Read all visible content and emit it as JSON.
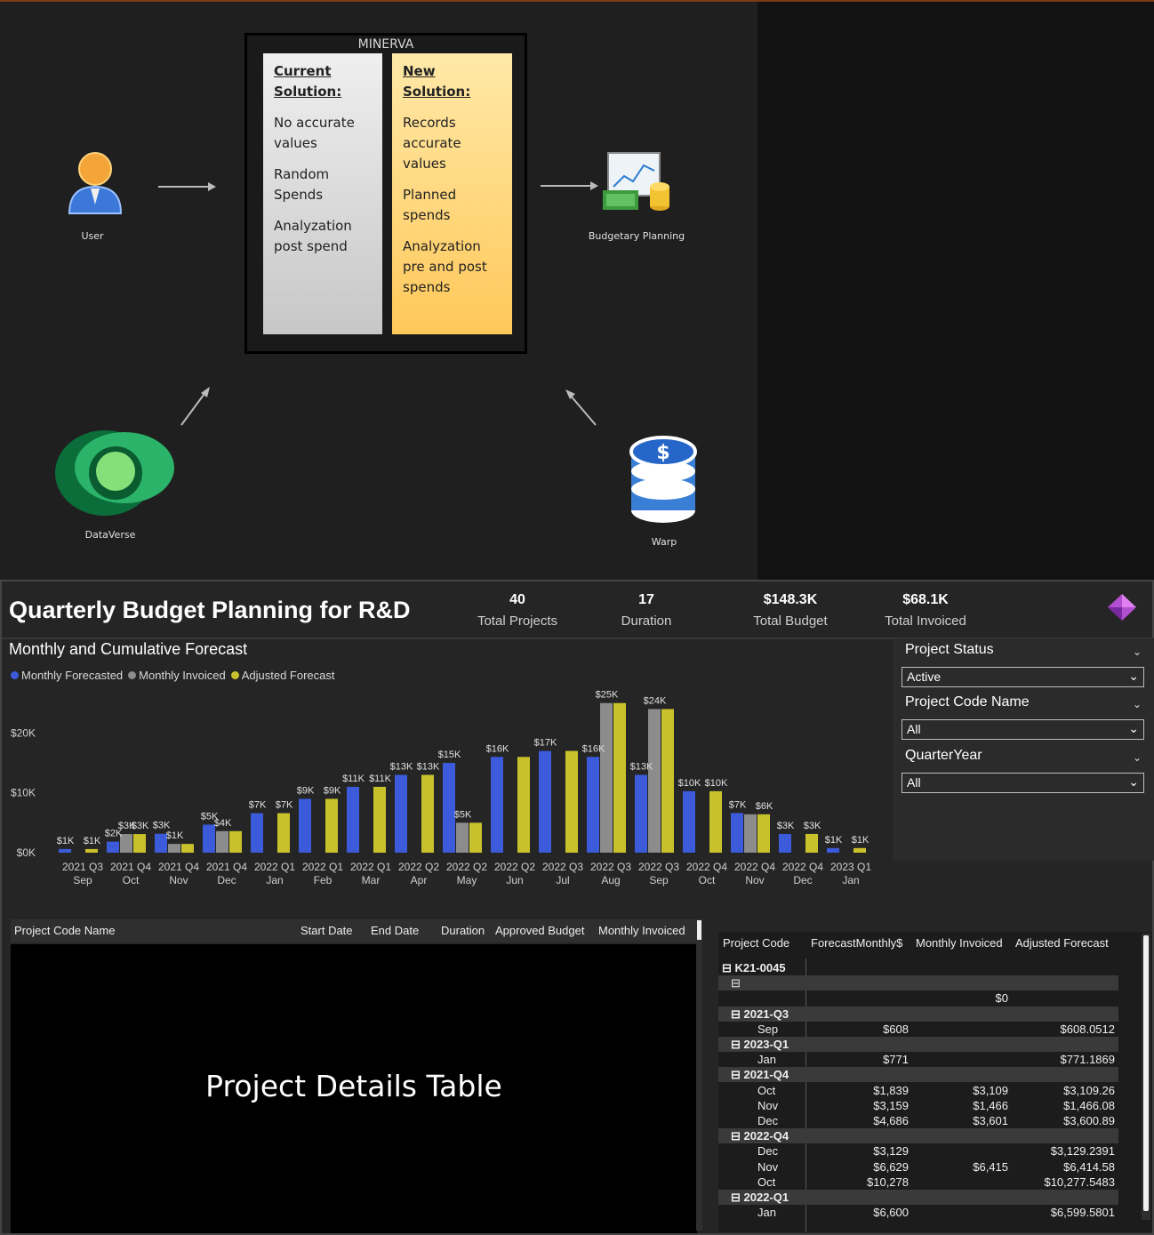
{
  "diagram": {
    "minerva_title": "MINERVA",
    "current": {
      "heading_1": "Current",
      "heading_2": "Solution:",
      "items": [
        "No accurate values",
        "Random Spends",
        "Analyzation post spend"
      ]
    },
    "new": {
      "heading_1": "New",
      "heading_2": "Solution:",
      "items": [
        "Records accurate values",
        "Planned spends",
        "Analyzation pre and post spends"
      ]
    },
    "nodes": {
      "user": "User",
      "budgetary": "Budgetary Planning",
      "dataverse": "DataVerse",
      "warp": "Warp"
    }
  },
  "dashboard": {
    "title": "Quarterly Budget Planning for R&D",
    "kpis": [
      {
        "value": "40",
        "label": "Total Projects"
      },
      {
        "value": "17",
        "label": "Duration"
      },
      {
        "value": "$148.3K",
        "label": "Total Budget"
      },
      {
        "value": "$68.1K",
        "label": "Total Invoiced"
      }
    ],
    "chart_title": "Monthly and Cumulative Forecast",
    "colors": {
      "forecasted": "#3b5bdb",
      "invoiced": "#8c8c8c",
      "adjusted": "#c9c12c"
    }
  },
  "chart_data": {
    "type": "bar",
    "title": "Monthly and Cumulative Forecast",
    "y_tick_labels": [
      "$0K",
      "$10K",
      "$20K"
    ],
    "ylim": [
      0,
      26000
    ],
    "categories": [
      [
        "2021 Q3",
        "Sep"
      ],
      [
        "2021 Q4",
        "Oct"
      ],
      [
        "2021 Q4",
        "Nov"
      ],
      [
        "2021 Q4",
        "Dec"
      ],
      [
        "2022 Q1",
        "Jan"
      ],
      [
        "2022 Q1",
        "Feb"
      ],
      [
        "2022 Q1",
        "Mar"
      ],
      [
        "2022 Q2",
        "Apr"
      ],
      [
        "2022 Q2",
        "May"
      ],
      [
        "2022 Q2",
        "Jun"
      ],
      [
        "2022 Q3",
        "Jul"
      ],
      [
        "2022 Q3",
        "Aug"
      ],
      [
        "2022 Q3",
        "Sep"
      ],
      [
        "2022 Q4",
        "Oct"
      ],
      [
        "2022 Q4",
        "Nov"
      ],
      [
        "2022 Q4",
        "Dec"
      ],
      [
        "2023 Q1",
        "Jan"
      ]
    ],
    "series": [
      {
        "name": "Monthly Forecasted",
        "color": "#3b5bdb",
        "values": [
          608,
          1839,
          3159,
          4686,
          6600,
          9000,
          11000,
          13000,
          15000,
          16000,
          17000,
          16000,
          13000,
          10278,
          6629,
          3129,
          771
        ]
      },
      {
        "name": "Monthly Invoiced",
        "color": "#8c8c8c",
        "values": [
          null,
          3109,
          1466,
          3601,
          null,
          null,
          null,
          null,
          5000,
          null,
          null,
          25000,
          24000,
          null,
          6415,
          null,
          null
        ]
      },
      {
        "name": "Adjusted Forecast",
        "color": "#c9c12c",
        "values": [
          608,
          3109,
          1466,
          3601,
          6600,
          9000,
          11000,
          13000,
          5000,
          16000,
          17000,
          25000,
          24000,
          10278,
          6415,
          3129,
          771
        ]
      }
    ],
    "data_labels": [
      [
        [
          "$1K",
          0
        ],
        [
          "$1K",
          2
        ]
      ],
      [
        [
          "$2K",
          0
        ],
        [
          "$3K",
          1
        ],
        [
          "$3K",
          2
        ]
      ],
      [
        [
          "$3K",
          0
        ],
        [
          "$1K",
          1
        ]
      ],
      [
        [
          "$5K",
          0
        ],
        [
          "$4K",
          1
        ]
      ],
      [
        [
          "$7K",
          0
        ],
        [
          "$7K",
          2
        ]
      ],
      [
        [
          "$9K",
          0
        ],
        [
          "$9K",
          2
        ]
      ],
      [
        [
          "$11K",
          0
        ],
        [
          "$11K",
          2
        ]
      ],
      [
        [
          "$13K",
          0
        ],
        [
          "$13K",
          2
        ]
      ],
      [
        [
          "$15K",
          0
        ],
        [
          "$5K",
          1
        ]
      ],
      [
        [
          "$16K",
          0
        ]
      ],
      [
        [
          "$17K",
          0
        ]
      ],
      [
        [
          "$16K",
          0
        ],
        [
          "$25K",
          1
        ]
      ],
      [
        [
          "$13K",
          0
        ],
        [
          "$24K",
          1
        ]
      ],
      [
        [
          "$10K",
          0
        ],
        [
          "$10K",
          2
        ]
      ],
      [
        [
          "$7K",
          0
        ],
        [
          "$6K",
          2
        ]
      ],
      [
        [
          "$3K",
          0
        ],
        [
          "$3K",
          2
        ]
      ],
      [
        [
          "$1K",
          0
        ],
        [
          "$1K",
          2
        ]
      ]
    ]
  },
  "slicers": [
    {
      "label": "Project Status",
      "value": "Active"
    },
    {
      "label": "Project Code Name",
      "value": "All"
    },
    {
      "label": "QuarterYear",
      "value": "All"
    }
  ],
  "left_table": {
    "columns": [
      "Project Code Name",
      "Start Date",
      "End Date",
      "Duration",
      "Approved Budget",
      "Monthly Invoiced"
    ],
    "placeholder": "Project Details Table"
  },
  "right_table": {
    "columns": [
      "Project Code",
      "ForecastMonthly$",
      "Monthly Invoiced",
      "Adjusted Forecast"
    ],
    "rows": [
      {
        "label": "⊟  K21-0045",
        "indent": 0,
        "bold": true,
        "c1": "",
        "c2": "",
        "c3": "",
        "shade": false
      },
      {
        "label": "⊟",
        "indent": 1,
        "bold": false,
        "c1": "",
        "c2": "",
        "c3": "",
        "shade": true
      },
      {
        "label": "",
        "indent": 2,
        "bold": false,
        "c1": "",
        "c2": "$0",
        "c3": "",
        "shade": false
      },
      {
        "label": "⊟  2021-Q3",
        "indent": 1,
        "bold": true,
        "c1": "",
        "c2": "",
        "c3": "",
        "shade": true
      },
      {
        "label": "Sep",
        "indent": 3,
        "bold": false,
        "c1": "$608",
        "c2": "",
        "c3": "$608.0512",
        "shade": false
      },
      {
        "label": "⊟  2023-Q1",
        "indent": 1,
        "bold": true,
        "c1": "",
        "c2": "",
        "c3": "",
        "shade": true
      },
      {
        "label": "Jan",
        "indent": 3,
        "bold": false,
        "c1": "$771",
        "c2": "",
        "c3": "$771.1869",
        "shade": false
      },
      {
        "label": "⊟  2021-Q4",
        "indent": 1,
        "bold": true,
        "c1": "",
        "c2": "",
        "c3": "",
        "shade": true
      },
      {
        "label": "Oct",
        "indent": 3,
        "bold": false,
        "c1": "$1,839",
        "c2": "$3,109",
        "c3": "$3,109.26",
        "shade": false
      },
      {
        "label": "Nov",
        "indent": 3,
        "bold": false,
        "c1": "$3,159",
        "c2": "$1,466",
        "c3": "$1,466.08",
        "shade": false
      },
      {
        "label": "Dec",
        "indent": 3,
        "bold": false,
        "c1": "$4,686",
        "c2": "$3,601",
        "c3": "$3,600.89",
        "shade": false
      },
      {
        "label": "⊟  2022-Q4",
        "indent": 1,
        "bold": true,
        "c1": "",
        "c2": "",
        "c3": "",
        "shade": true
      },
      {
        "label": "Dec",
        "indent": 3,
        "bold": false,
        "c1": "$3,129",
        "c2": "",
        "c3": "$3,129.2391",
        "shade": false
      },
      {
        "label": "Nov",
        "indent": 3,
        "bold": false,
        "c1": "$6,629",
        "c2": "$6,415",
        "c3": "$6,414.58",
        "shade": false
      },
      {
        "label": "Oct",
        "indent": 3,
        "bold": false,
        "c1": "$10,278",
        "c2": "",
        "c3": "$10,277.5483",
        "shade": false
      },
      {
        "label": "⊟  2022-Q1",
        "indent": 1,
        "bold": true,
        "c1": "",
        "c2": "",
        "c3": "",
        "shade": true
      },
      {
        "label": "Jan",
        "indent": 3,
        "bold": false,
        "c1": "$6,600",
        "c2": "",
        "c3": "$6,599.5801",
        "shade": false
      }
    ]
  }
}
